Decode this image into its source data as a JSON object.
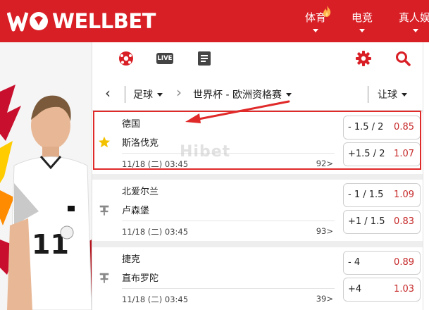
{
  "brand": {
    "name": "WELLBET",
    "mark": "WB"
  },
  "nav": {
    "items": [
      {
        "label": "体育",
        "badge": "flame-icon"
      },
      {
        "label": "电竞"
      },
      {
        "label": "真人娱"
      }
    ]
  },
  "toolbar": {
    "icons": [
      "soccer-ball-icon",
      "live-icon",
      "document-icon",
      "settings-icon",
      "search-icon"
    ],
    "live_label": "LIVE"
  },
  "filter": {
    "back": "‹",
    "sport": "足球",
    "chevron": "›",
    "league": "世界杯 - 欧洲资格赛",
    "market": "让球"
  },
  "matches": [
    {
      "home": "德国",
      "away": "斯洛伐克",
      "date": "11/18 (二) 03:45",
      "count": "92>",
      "favorite": true,
      "odds": [
        {
          "handicap": "- 1.5 / 2",
          "value": "0.85"
        },
        {
          "handicap": "+1.5 / 2",
          "value": "1.07"
        }
      ]
    },
    {
      "home": "北爱尔兰",
      "away": "卢森堡",
      "date": "11/18 (二) 03:45",
      "count": "93>",
      "favorite": false,
      "odds": [
        {
          "handicap": "- 1 / 1.5",
          "value": "1.09"
        },
        {
          "handicap": "+1 / 1.5",
          "value": "0.83"
        }
      ]
    },
    {
      "home": "捷克",
      "away": "直布罗陀",
      "date": "11/18 (二) 03:45",
      "count": "39>",
      "favorite": false,
      "odds": [
        {
          "handicap": "- 4",
          "value": "0.89"
        },
        {
          "handicap": "+4",
          "value": "1.03"
        }
      ]
    }
  ],
  "watermark": "Hibet",
  "colors": {
    "brand_red": "#d91f26",
    "odds_red": "#c62828",
    "highlight": "#e02a2a",
    "star": "#f2c200"
  }
}
